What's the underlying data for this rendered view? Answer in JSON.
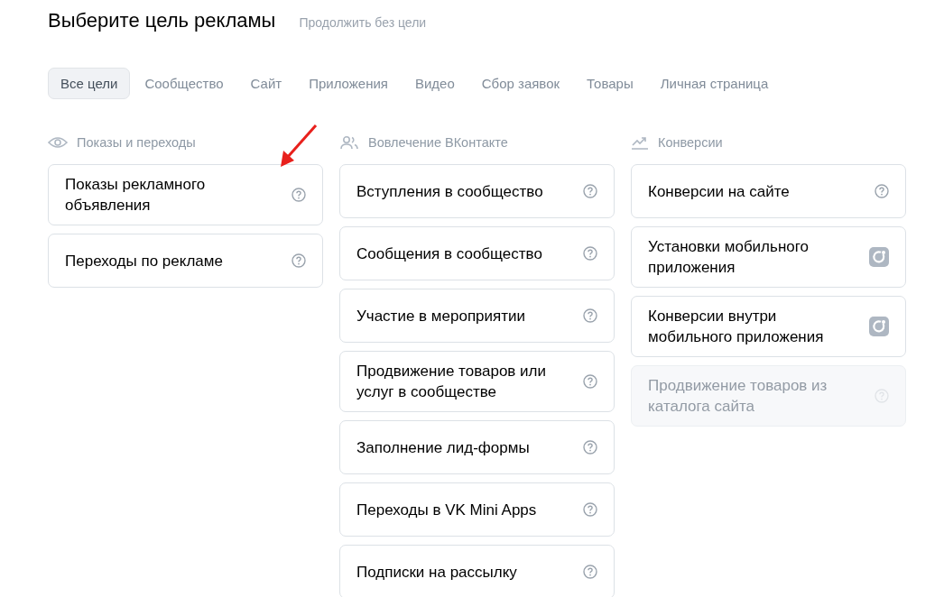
{
  "title": "Выберите цель рекламы",
  "skip_link": "Продолжить без цели",
  "tabs": [
    {
      "label": "Все цели",
      "selected": true
    },
    {
      "label": "Сообщество",
      "selected": false
    },
    {
      "label": "Сайт",
      "selected": false
    },
    {
      "label": "Приложения",
      "selected": false
    },
    {
      "label": "Видео",
      "selected": false
    },
    {
      "label": "Сбор заявок",
      "selected": false
    },
    {
      "label": "Товары",
      "selected": false
    },
    {
      "label": "Личная страница",
      "selected": false
    }
  ],
  "sections": [
    {
      "kind": "eye",
      "title": "Показы и переходы",
      "items": [
        {
          "label": "Показы рекламного объявления",
          "kind": "help",
          "disabled": false
        },
        {
          "label": "Переходы по рекламе",
          "kind": "help",
          "disabled": false
        }
      ]
    },
    {
      "kind": "people",
      "title": "Вовлечение ВКонтакте",
      "items": [
        {
          "label": "Вступления в сообщество",
          "kind": "help",
          "disabled": false
        },
        {
          "label": "Сообщения в сообщество",
          "kind": "help",
          "disabled": false
        },
        {
          "label": "Участие в мероприятии",
          "kind": "help",
          "disabled": false
        },
        {
          "label": "Продвижение товаров или услуг в сообществе",
          "kind": "help",
          "disabled": false
        },
        {
          "label": "Заполнение лид-формы",
          "kind": "help",
          "disabled": false
        },
        {
          "label": "Переходы в VK Mini Apps",
          "kind": "help",
          "disabled": false
        },
        {
          "label": "Подписки на рассылку",
          "kind": "help",
          "disabled": false
        }
      ]
    },
    {
      "kind": "trend",
      "title": "Конверсии",
      "items": [
        {
          "label": "Конверсии на сайте",
          "kind": "help",
          "disabled": false
        },
        {
          "label": "Установки мобильного приложения",
          "kind": "app",
          "disabled": false
        },
        {
          "label": "Конверсии внутри мобильного приложения",
          "kind": "app",
          "disabled": false
        },
        {
          "label": "Продвижение товаров из каталога сайта",
          "kind": "help",
          "disabled": true
        }
      ]
    }
  ]
}
